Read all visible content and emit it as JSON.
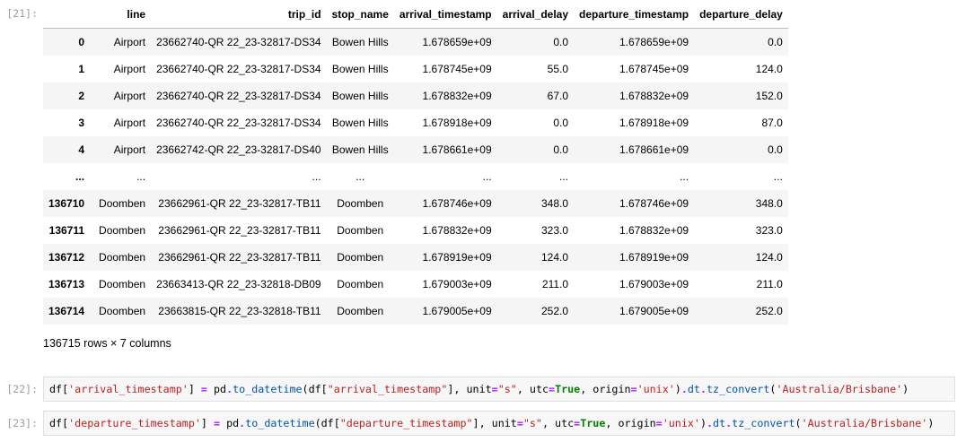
{
  "cells": {
    "out21_prompt": "[21]:",
    "in22_prompt": "[22]:",
    "in23_prompt": "[23]:"
  },
  "table": {
    "columns": [
      "line",
      "trip_id",
      "stop_name",
      "arrival_timestamp",
      "arrival_delay",
      "departure_timestamp",
      "departure_delay"
    ],
    "rows": [
      {
        "idx": "0",
        "line": "Airport",
        "trip_id": "23662740-QR 22_23-32817-DS34",
        "stop_name": "Bowen Hills",
        "arr_ts": "1.678659e+09",
        "arr_delay": "0.0",
        "dep_ts": "1.678659e+09",
        "dep_delay": "0.0"
      },
      {
        "idx": "1",
        "line": "Airport",
        "trip_id": "23662740-QR 22_23-32817-DS34",
        "stop_name": "Bowen Hills",
        "arr_ts": "1.678745e+09",
        "arr_delay": "55.0",
        "dep_ts": "1.678745e+09",
        "dep_delay": "124.0"
      },
      {
        "idx": "2",
        "line": "Airport",
        "trip_id": "23662740-QR 22_23-32817-DS34",
        "stop_name": "Bowen Hills",
        "arr_ts": "1.678832e+09",
        "arr_delay": "67.0",
        "dep_ts": "1.678832e+09",
        "dep_delay": "152.0"
      },
      {
        "idx": "3",
        "line": "Airport",
        "trip_id": "23662740-QR 22_23-32817-DS34",
        "stop_name": "Bowen Hills",
        "arr_ts": "1.678918e+09",
        "arr_delay": "0.0",
        "dep_ts": "1.678918e+09",
        "dep_delay": "87.0"
      },
      {
        "idx": "4",
        "line": "Airport",
        "trip_id": "23662742-QR 22_23-32817-DS40",
        "stop_name": "Bowen Hills",
        "arr_ts": "1.678661e+09",
        "arr_delay": "0.0",
        "dep_ts": "1.678661e+09",
        "dep_delay": "0.0"
      },
      {
        "idx": "...",
        "line": "...",
        "trip_id": "...",
        "stop_name": "...",
        "arr_ts": "...",
        "arr_delay": "...",
        "dep_ts": "...",
        "dep_delay": "..."
      },
      {
        "idx": "136710",
        "line": "Doomben",
        "trip_id": "23662961-QR 22_23-32817-TB11",
        "stop_name": "Doomben",
        "arr_ts": "1.678746e+09",
        "arr_delay": "348.0",
        "dep_ts": "1.678746e+09",
        "dep_delay": "348.0"
      },
      {
        "idx": "136711",
        "line": "Doomben",
        "trip_id": "23662961-QR 22_23-32817-TB11",
        "stop_name": "Doomben",
        "arr_ts": "1.678832e+09",
        "arr_delay": "323.0",
        "dep_ts": "1.678832e+09",
        "dep_delay": "323.0"
      },
      {
        "idx": "136712",
        "line": "Doomben",
        "trip_id": "23662961-QR 22_23-32817-TB11",
        "stop_name": "Doomben",
        "arr_ts": "1.678919e+09",
        "arr_delay": "124.0",
        "dep_ts": "1.678919e+09",
        "dep_delay": "124.0"
      },
      {
        "idx": "136713",
        "line": "Doomben",
        "trip_id": "23663413-QR 22_23-32818-DB09",
        "stop_name": "Doomben",
        "arr_ts": "1.679003e+09",
        "arr_delay": "211.0",
        "dep_ts": "1.679003e+09",
        "dep_delay": "211.0"
      },
      {
        "idx": "136714",
        "line": "Doomben",
        "trip_id": "23663815-QR 22_23-32818-TB11",
        "stop_name": "Doomben",
        "arr_ts": "1.679005e+09",
        "arr_delay": "252.0",
        "dep_ts": "1.679005e+09",
        "dep_delay": "252.0"
      }
    ],
    "shape_text": "136715 rows × 7 columns"
  },
  "code22": [
    {
      "t": "df[",
      "c": ""
    },
    {
      "t": "'arrival_timestamp'",
      "c": "s"
    },
    {
      "t": "] ",
      "c": ""
    },
    {
      "t": "=",
      "c": "o"
    },
    {
      "t": " pd",
      "c": ""
    },
    {
      "t": ".",
      "c": "o"
    },
    {
      "t": "to_datetime",
      "c": "f"
    },
    {
      "t": "(df[",
      "c": ""
    },
    {
      "t": "\"arrival_timestamp\"",
      "c": "s"
    },
    {
      "t": "], unit",
      "c": ""
    },
    {
      "t": "=",
      "c": "o"
    },
    {
      "t": "\"s\"",
      "c": "s"
    },
    {
      "t": ", utc",
      "c": ""
    },
    {
      "t": "=",
      "c": "o"
    },
    {
      "t": "True",
      "c": "k"
    },
    {
      "t": ", origin",
      "c": ""
    },
    {
      "t": "=",
      "c": "o"
    },
    {
      "t": "'unix'",
      "c": "s"
    },
    {
      "t": ")",
      "c": ""
    },
    {
      "t": ".",
      "c": "o"
    },
    {
      "t": "dt",
      "c": "f"
    },
    {
      "t": ".",
      "c": "o"
    },
    {
      "t": "tz_convert",
      "c": "f"
    },
    {
      "t": "(",
      "c": ""
    },
    {
      "t": "'Australia/Brisbane'",
      "c": "s"
    },
    {
      "t": ")",
      "c": ""
    }
  ],
  "code23": [
    {
      "t": "df[",
      "c": ""
    },
    {
      "t": "'departure_timestamp'",
      "c": "s"
    },
    {
      "t": "] ",
      "c": ""
    },
    {
      "t": "=",
      "c": "o"
    },
    {
      "t": " pd",
      "c": ""
    },
    {
      "t": ".",
      "c": "o"
    },
    {
      "t": "to_datetime",
      "c": "f"
    },
    {
      "t": "(df[",
      "c": ""
    },
    {
      "t": "\"departure_timestamp\"",
      "c": "s"
    },
    {
      "t": "], unit",
      "c": ""
    },
    {
      "t": "=",
      "c": "o"
    },
    {
      "t": "\"s\"",
      "c": "s"
    },
    {
      "t": ", utc",
      "c": ""
    },
    {
      "t": "=",
      "c": "o"
    },
    {
      "t": "True",
      "c": "k"
    },
    {
      "t": ", origin",
      "c": ""
    },
    {
      "t": "=",
      "c": "o"
    },
    {
      "t": "'unix'",
      "c": "s"
    },
    {
      "t": ")",
      "c": ""
    },
    {
      "t": ".",
      "c": "o"
    },
    {
      "t": "dt",
      "c": "f"
    },
    {
      "t": ".",
      "c": "o"
    },
    {
      "t": "tz_convert",
      "c": "f"
    },
    {
      "t": "(",
      "c": ""
    },
    {
      "t": "'Australia/Brisbane'",
      "c": "s"
    },
    {
      "t": ")",
      "c": ""
    }
  ]
}
